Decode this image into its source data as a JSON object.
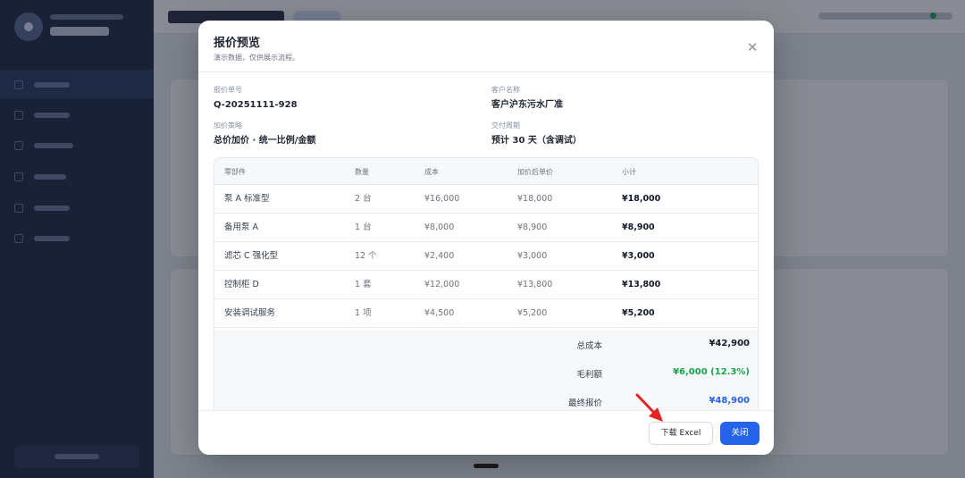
{
  "modal": {
    "title": "报价预览",
    "subtitle": "演示数据，仅供展示流程。",
    "close_icon": "close-icon",
    "fields": {
      "quote_no": {
        "label": "报价单号",
        "value": "Q-20251111-928"
      },
      "customer": {
        "label": "客户名称",
        "value": "客户沪东污水厂准"
      },
      "strategy": {
        "label": "加价策略",
        "value": "总价加价 · 统一比例/金额"
      },
      "delivery": {
        "label": "交付周期",
        "value": "预计 30 天（含调试）"
      }
    },
    "table": {
      "headers": [
        "零部件",
        "数量",
        "成本",
        "加价后单价",
        "小计"
      ],
      "rows": [
        [
          "泵 A 标准型",
          "2 台",
          "¥16,000",
          "¥18,000",
          "¥18,000"
        ],
        [
          "备用泵 A",
          "1 台",
          "¥8,000",
          "¥8,900",
          "¥8,900"
        ],
        [
          "滤芯 C 强化型",
          "12 个",
          "¥2,400",
          "¥3,000",
          "¥3,000"
        ],
        [
          "控制柜 D",
          "1 套",
          "¥12,000",
          "¥13,800",
          "¥13,800"
        ],
        [
          "安装调试服务",
          "1 项",
          "¥4,500",
          "¥5,200",
          "¥5,200"
        ]
      ]
    },
    "summary": {
      "total_cost": {
        "label": "总成本",
        "value": "¥42,900"
      },
      "gross_profit": {
        "label": "毛利额",
        "value": "¥6,000 (12.3%)"
      },
      "final_price": {
        "label": "最终报价",
        "value": "¥48,900"
      }
    },
    "buttons": {
      "download": "下载 Excel",
      "close": "关闭"
    }
  },
  "colors": {
    "primary": "#2563eb",
    "profit_green": "#16a34a",
    "annotation_arrow": "#e02424"
  }
}
